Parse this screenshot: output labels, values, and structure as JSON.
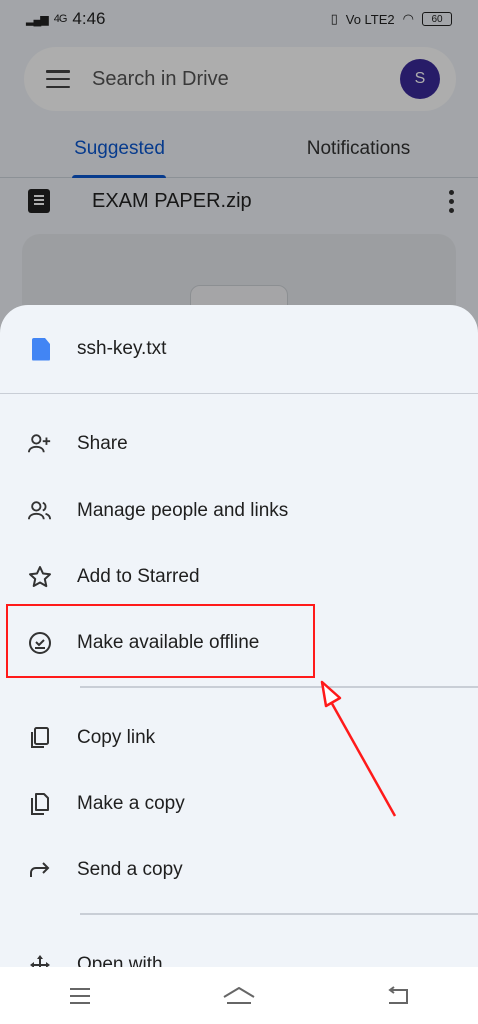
{
  "status_bar": {
    "network": "4G",
    "time": "4:46",
    "network_label": "Vo LTE2",
    "battery": "60"
  },
  "search": {
    "placeholder": "Search in Drive",
    "avatar_initial": "S"
  },
  "tabs": [
    {
      "label": "Suggested",
      "active": true
    },
    {
      "label": "Notifications",
      "active": false
    }
  ],
  "file_row": {
    "name": "EXAM PAPER.zip"
  },
  "sheet": {
    "file_name": "ssh-key.txt",
    "items": [
      {
        "label": "Share",
        "icon": "person-add-icon"
      },
      {
        "label": "Manage people and links",
        "icon": "people-icon"
      },
      {
        "label": "Add to Starred",
        "icon": "star-icon"
      },
      {
        "label": "Make available offline",
        "icon": "offline-check-icon"
      },
      {
        "label": "Copy link",
        "icon": "copy-icon"
      },
      {
        "label": "Make a copy",
        "icon": "file-copy-icon"
      },
      {
        "label": "Send a copy",
        "icon": "send-arrow-icon"
      },
      {
        "label": "Open with",
        "icon": "open-with-icon"
      }
    ]
  },
  "annotation": {
    "color": "#ff1a1a"
  },
  "colors": {
    "accent": "#0b57d0",
    "doc_icon": "#4285f4",
    "avatar": "#3a2a9a"
  }
}
